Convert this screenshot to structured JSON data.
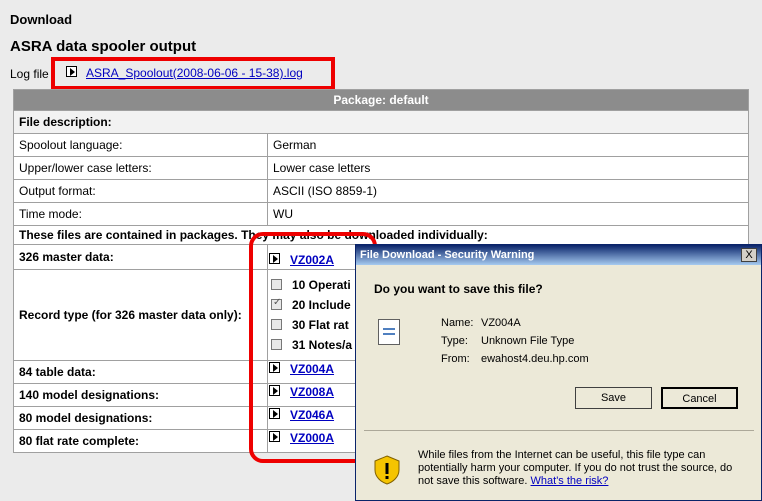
{
  "page": {
    "section_title": "Download",
    "title": "ASRA data spooler output",
    "log_label": "Log file",
    "log_link": "ASRA_Spoolout(2008-06-06 - 15-38).log"
  },
  "package": {
    "header": "Package: default",
    "file_description": "File description:",
    "rows": [
      {
        "label": "Spoolout language:",
        "value": "German"
      },
      {
        "label": "Upper/lower case letters:",
        "value": "Lower case letters"
      },
      {
        "label": "Output format:",
        "value": "ASCII (ISO 8859-1)"
      },
      {
        "label": "Time mode:",
        "value": "WU"
      }
    ],
    "contained_text": "These files are contained in packages. They may also be downloaded individually:",
    "master": {
      "label": "326 master data:",
      "link": "VZ002A"
    },
    "record_type": {
      "label": "Record type (for 326 master data only):",
      "options": [
        {
          "label": "10 Operati",
          "checked": false
        },
        {
          "label": "20 Include",
          "checked": true
        },
        {
          "label": "30 Flat rat",
          "checked": false
        },
        {
          "label": "31 Notes/a",
          "checked": false
        }
      ]
    },
    "files": [
      {
        "label": "84 table data:",
        "link": "VZ004A"
      },
      {
        "label": "140 model designations:",
        "link": "VZ008A"
      },
      {
        "label": "80 model designations:",
        "link": "VZ046A"
      },
      {
        "label": "80 flat rate complete:",
        "link": "VZ000A"
      }
    ]
  },
  "dialog": {
    "title": "File Download - Security Warning",
    "close": "X",
    "question": "Do you want to save this file?",
    "name_label": "Name:",
    "name_value": "VZ004A",
    "type_label": "Type:",
    "type_value": "Unknown File Type",
    "from_label": "From:",
    "from_value": "ewahost4.deu.hp.com",
    "save": "Save",
    "cancel": "Cancel",
    "warning": "While files from the Internet can be useful, this file type can potentially harm your computer. If you do not trust the source, do not save this software.",
    "risk_link": "What's the risk?"
  },
  "colors": {
    "highlight": "#ee0000",
    "link": "#0000c0",
    "table_header": "#8c8c8c"
  }
}
